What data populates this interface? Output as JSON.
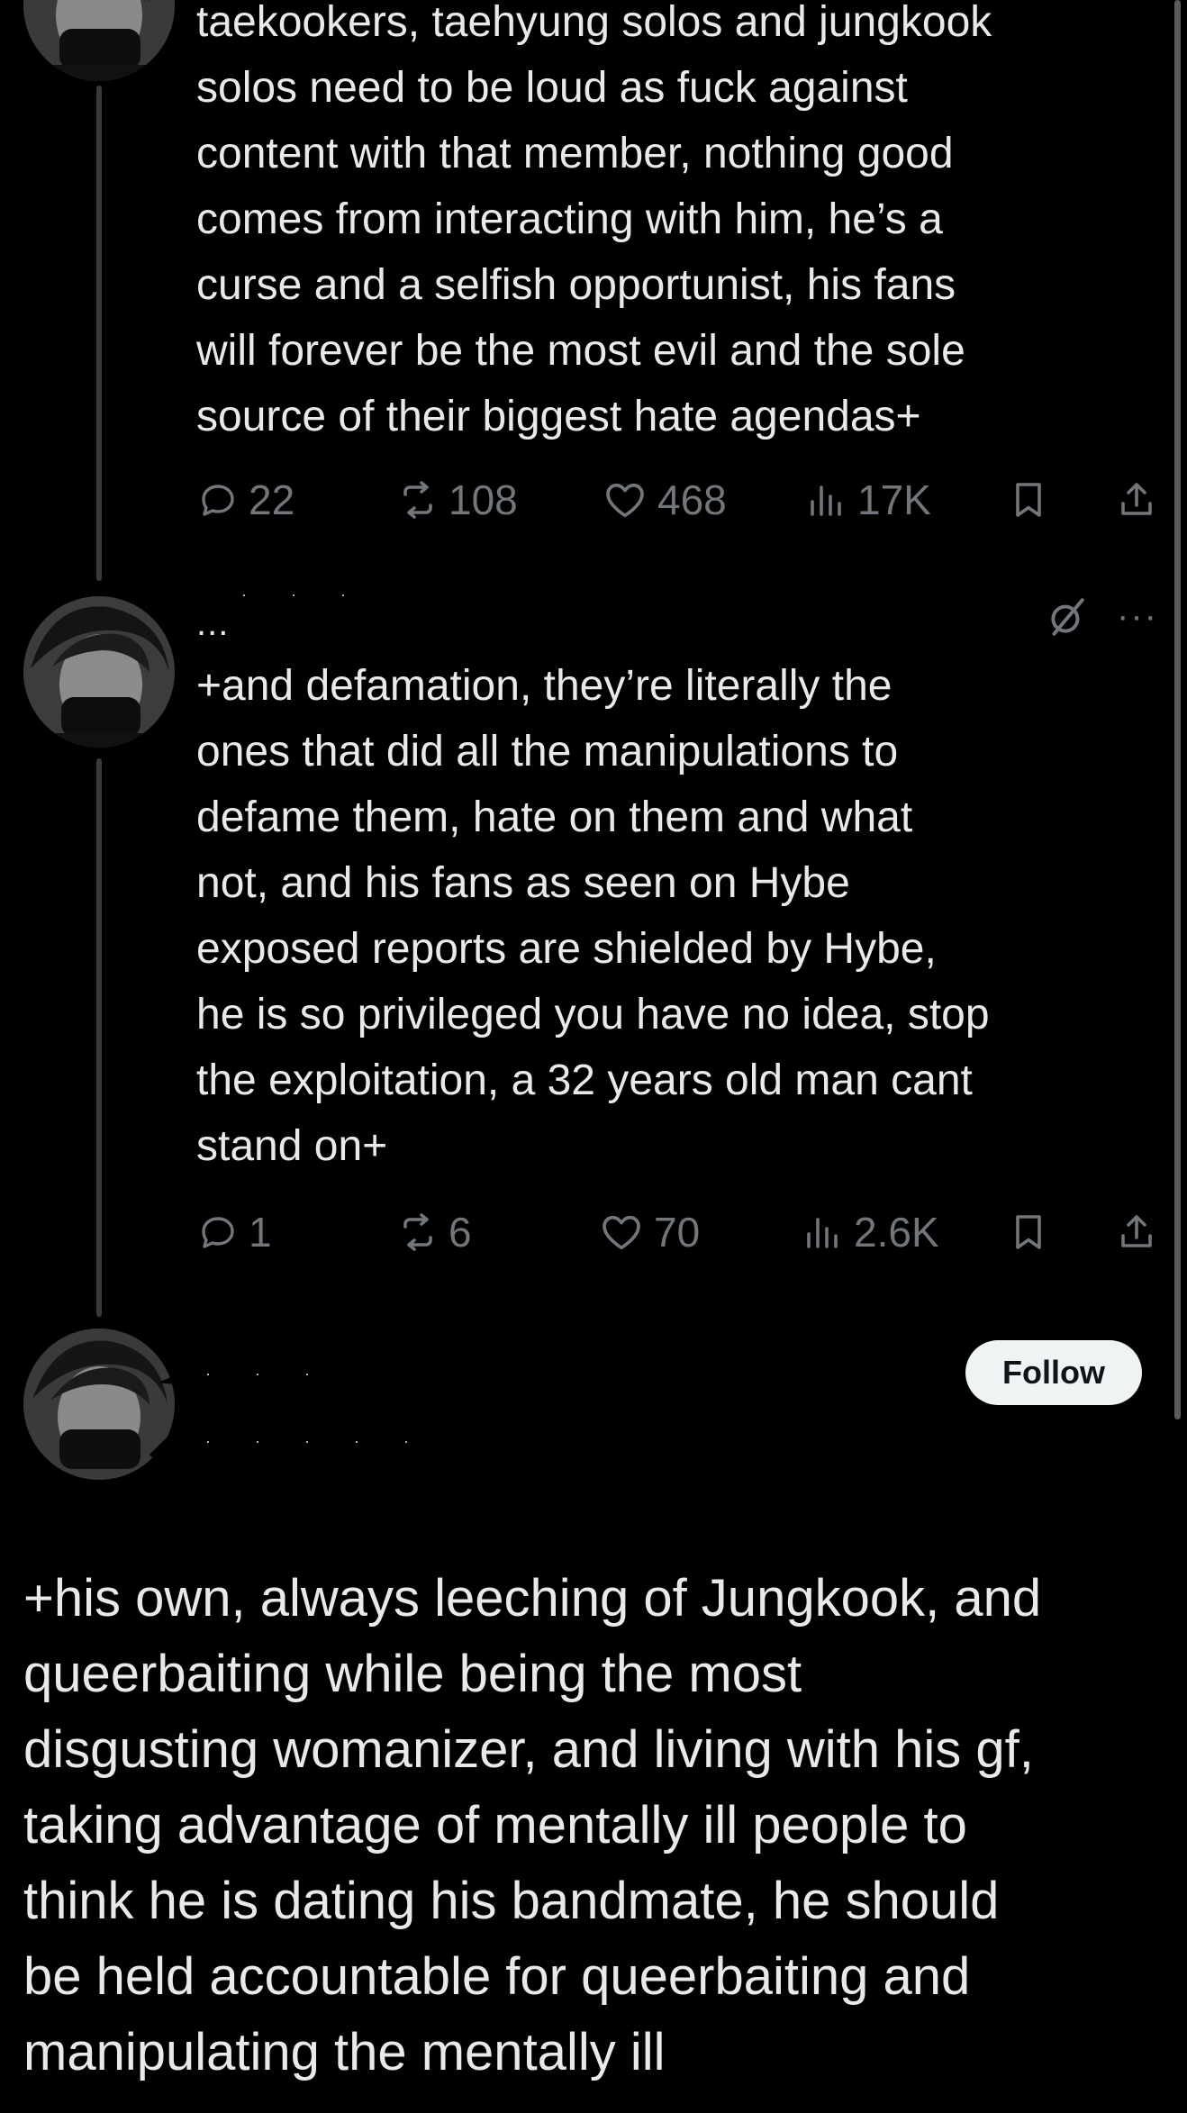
{
  "tweets": [
    {
      "text": "taekookers, taehyung solos and jungkook\nsolos need to be loud as fuck against\ncontent with that member, nothing good\ncomes from interacting with him, he’s a\ncurse and a selfish opportunist, his fans\nwill forever be the most evil and the sole\nsource of their biggest hate agendas+",
      "replies": "22",
      "reposts": "108",
      "likes": "468",
      "views": "17K"
    },
    {
      "handle": "...",
      "more": "···",
      "text": "+and defamation, they’re literally the\nones that did all the manipulations to\ndefame them, hate on them and what\nnot, and his fans as seen on Hybe\nexposed reports are shielded by Hybe,\nhe is so privileged you have no idea, stop\nthe exploitation, a 32 years old man cant\nstand on+",
      "replies": "1",
      "reposts": "6",
      "likes": "70",
      "views": "2.6K"
    }
  ],
  "main_tweet": {
    "follow_label": "Follow",
    "text": "+his own, always leeching of Jungkook, and\nqueerbaiting while being the most\ndisgusting womanizer, and living with his gf,\ntaking advantage of mentally ill people to\nthink he is dating his bandmate, he should\nbe held accountable for queerbaiting and\nmanipulating the mentally ill"
  },
  "icons": [
    "reply-icon",
    "repost-icon",
    "like-icon",
    "views-icon",
    "bookmark-icon",
    "share-icon",
    "grok-icon",
    "more-icon"
  ],
  "colors": {
    "background": "#000000",
    "text": "#e7e9ea",
    "secondary": "#71767b",
    "follow_bg": "#eff3f4",
    "follow_text": "#0f1419"
  }
}
